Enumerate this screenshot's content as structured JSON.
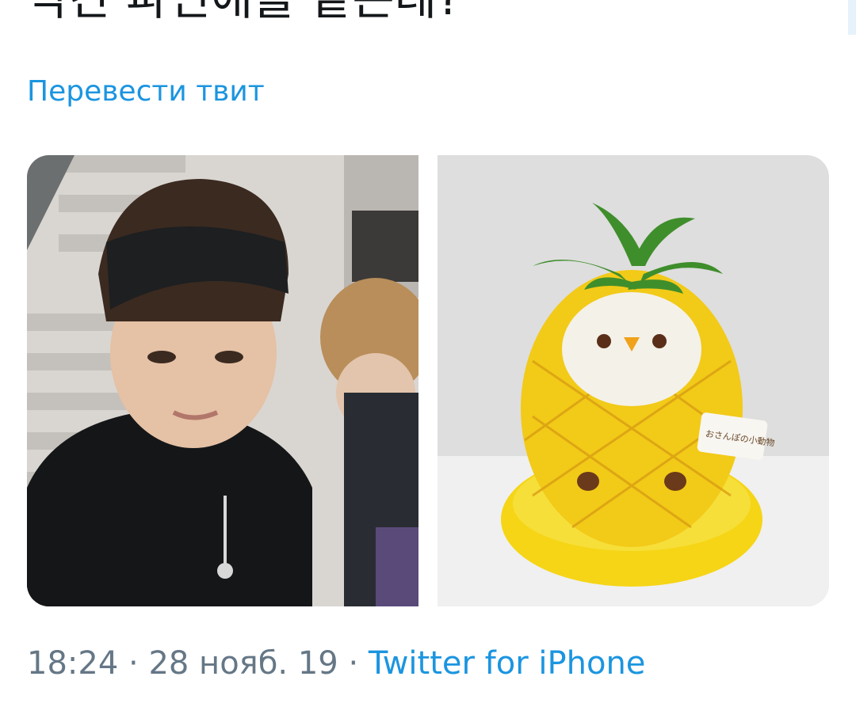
{
  "tweet": {
    "text": "약간 파인애플 같은데?",
    "translate_label": "Перевести твит",
    "time": "18:24",
    "separator": "·",
    "date": "28 нояб. 19",
    "source": "Twitter for iPhone"
  },
  "media": [
    {
      "name": "person-photo"
    },
    {
      "name": "pineapple-chick-plush-photo",
      "tag_text": "おさんぽの小動物"
    }
  ],
  "colors": {
    "link": "#1b95e0",
    "meta_gray": "#657786",
    "text": "#14171a"
  }
}
